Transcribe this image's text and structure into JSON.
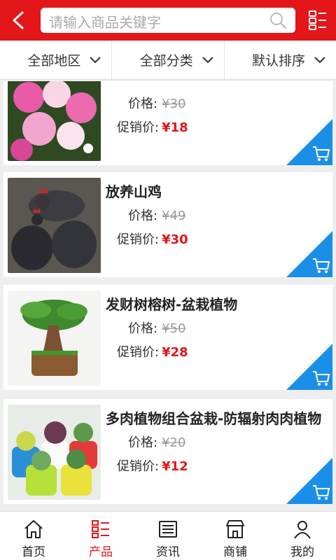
{
  "header": {
    "search_placeholder": "请输入商品关键字"
  },
  "filters": [
    {
      "label": "全部地区"
    },
    {
      "label": "全部分类"
    },
    {
      "label": "默认排序"
    }
  ],
  "products": [
    {
      "title": "",
      "price_label": "价格:",
      "price": "¥30",
      "promo_label": "促销价:",
      "promo_price": "¥18",
      "image": "pink-flowers"
    },
    {
      "title": "放养山鸡",
      "price_label": "价格:",
      "price": "¥49",
      "promo_label": "促销价:",
      "promo_price": "¥30",
      "image": "chickens"
    },
    {
      "title": "发财树榕树-盆栽植物",
      "price_label": "价格:",
      "price": "¥50",
      "promo_label": "促销价:",
      "promo_price": "¥28",
      "image": "bonsai"
    },
    {
      "title": "多肉植物组合盆栽-防辐射肉肉植物",
      "price_label": "价格:",
      "price": "¥20",
      "promo_label": "促销价:",
      "promo_price": "¥12",
      "image": "succulents"
    }
  ],
  "tabbar": [
    {
      "label": "首页",
      "icon": "home-icon"
    },
    {
      "label": "产品",
      "icon": "grid-list-icon",
      "active": true
    },
    {
      "label": "资讯",
      "icon": "news-icon"
    },
    {
      "label": "商铺",
      "icon": "shop-icon"
    },
    {
      "label": "我的",
      "icon": "user-icon"
    }
  ],
  "colors": {
    "brand": "#e3161a",
    "cart_badge": "#1a8fe8"
  }
}
